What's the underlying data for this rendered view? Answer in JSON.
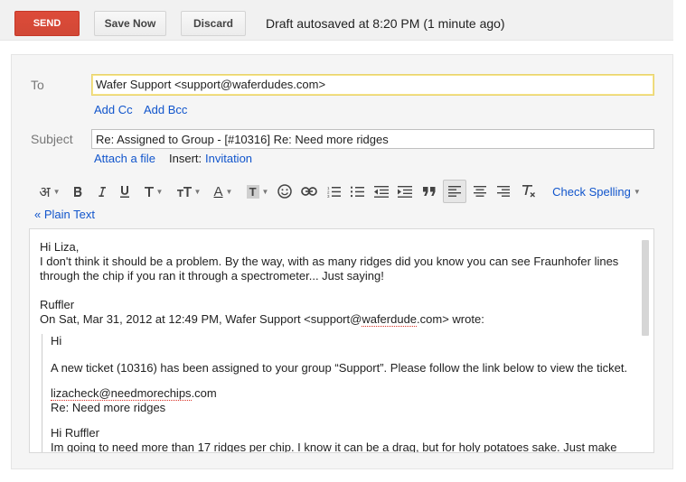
{
  "toolbar": {
    "send_label": "SEND",
    "save_now_label": "Save Now",
    "discard_label": "Discard",
    "autosave_status": "Draft autosaved at 8:20 PM (1 minute ago)"
  },
  "compose": {
    "to_label": "To",
    "to_value": "Wafer Support <support@waferdudes.com>",
    "add_cc": "Add Cc",
    "add_bcc": "Add Bcc",
    "subject_label": "Subject",
    "subject_value": "Re: Assigned to Group - [#10316] Re: Need more ridges",
    "attach_file": "Attach a file",
    "insert_label": "Insert:",
    "invitation": "Invitation"
  },
  "formatting": {
    "input_tool_glyph": "अ",
    "text_color_glyph": "A",
    "background_glyph": "T",
    "check_spelling": "Check Spelling",
    "plain_text": "« Plain Text",
    "icons": [
      "input-tools-icon",
      "bold-icon",
      "italic-icon",
      "underline-icon",
      "font-icon",
      "font-size-icon",
      "text-color-icon",
      "highlight-color-icon",
      "emoji-icon",
      "link-icon",
      "numbered-list-icon",
      "bulleted-list-icon",
      "indent-less-icon",
      "indent-more-icon",
      "quote-icon",
      "align-left-icon",
      "align-center-icon",
      "align-right-icon",
      "remove-formatting-icon"
    ]
  },
  "message": {
    "greeting": "Hi Liza,",
    "line1": "I don't think it should be a problem. By the way, with as many ridges did you know you can see Fraunhofer lines",
    "line2": "through the chip if you ran it through a spectrometer... Just saying!",
    "signature": "Ruffler",
    "attribution_prefix": "On Sat, Mar 31, 2012 at 12:49 PM, Wafer Support <support@",
    "attribution_misspelled": "waferdude",
    "attribution_suffix": ".com> wrote:",
    "quote_hi": "Hi",
    "quote_ticket": "A new ticket (10316) has been assigned to your group “Support”. Please follow the link below to view the ticket.",
    "quote_email_misspelled": "lizacheck@needmorechips",
    "quote_email_suffix": ".com",
    "quote_re": "Re: Need more ridges",
    "quote_hi_ruffler": "Hi Ruffler",
    "quote_cut_line": "Im going to need more than 17 ridges per chip. I know it can be a drag, but for holy potatoes sake.  Just make"
  }
}
